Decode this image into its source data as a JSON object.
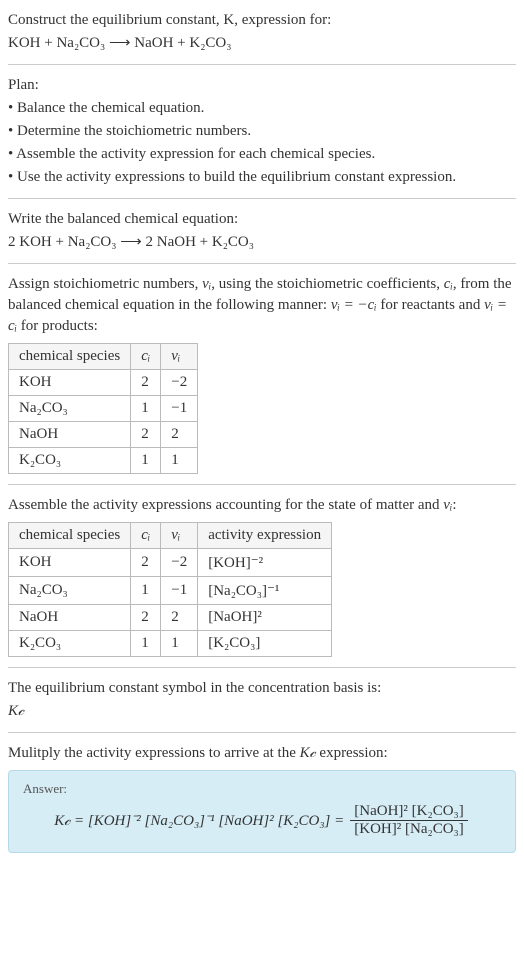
{
  "intro": {
    "line1": "Construct the equilibrium constant, K, expression for:",
    "eq": "KOH + Na₂CO₃ ⟶ NaOH + K₂CO₃"
  },
  "plan": {
    "title": "Plan:",
    "b1": "• Balance the chemical equation.",
    "b2": "• Determine the stoichiometric numbers.",
    "b3": "• Assemble the activity expression for each chemical species.",
    "b4": "• Use the activity expressions to build the equilibrium constant expression."
  },
  "balanced": {
    "title": "Write the balanced chemical equation:",
    "eq": "2 KOH + Na₂CO₃ ⟶ 2 NaOH + K₂CO₃"
  },
  "stoich": {
    "intro_a": "Assign stoichiometric numbers, ",
    "intro_b": ", using the stoichiometric coefficients, ",
    "intro_c": ", from the balanced chemical equation in the following manner: ",
    "intro_d": " for reactants and ",
    "intro_e": " for products:",
    "nu_i": "νᵢ",
    "c_i": "cᵢ",
    "rel_react": "νᵢ = −cᵢ",
    "rel_prod": "νᵢ = cᵢ",
    "h1": "chemical species",
    "h2": "cᵢ",
    "h3": "νᵢ",
    "r1s": "KOH",
    "r1c": "2",
    "r1n": "−2",
    "r2s": "Na₂CO₃",
    "r2c": "1",
    "r2n": "−1",
    "r3s": "NaOH",
    "r3c": "2",
    "r3n": "2",
    "r4s": "K₂CO₃",
    "r4c": "1",
    "r4n": "1"
  },
  "activity": {
    "intro_a": "Assemble the activity expressions accounting for the state of matter and ",
    "intro_b": ":",
    "nu_i": "νᵢ",
    "h1": "chemical species",
    "h2": "cᵢ",
    "h3": "νᵢ",
    "h4": "activity expression",
    "r1s": "KOH",
    "r1c": "2",
    "r1n": "−2",
    "r1a": "[KOH]⁻²",
    "r2s": "Na₂CO₃",
    "r2c": "1",
    "r2n": "−1",
    "r2a": "[Na₂CO₃]⁻¹",
    "r3s": "NaOH",
    "r3c": "2",
    "r3n": "2",
    "r3a": "[NaOH]²",
    "r4s": "K₂CO₃",
    "r4c": "1",
    "r4n": "1",
    "r4a": "[K₂CO₃]"
  },
  "kc_symbol": {
    "line": "The equilibrium constant symbol in the concentration basis is:",
    "sym": "K𝒸"
  },
  "multiply": {
    "line_a": "Mulitply the activity expressions to arrive at the ",
    "kc": "K𝒸",
    "line_b": " expression:"
  },
  "answer": {
    "label": "Answer:",
    "lhs": "K𝒸 = [KOH]⁻² [Na₂CO₃]⁻¹ [NaOH]² [K₂CO₃] = ",
    "frac_num": "[NaOH]² [K₂CO₃]",
    "frac_den": "[KOH]² [Na₂CO₃]"
  },
  "chart_data": {
    "type": "table",
    "tables": [
      {
        "title": "Stoichiometric numbers",
        "columns": [
          "chemical species",
          "cᵢ",
          "νᵢ"
        ],
        "rows": [
          [
            "KOH",
            2,
            -2
          ],
          [
            "Na₂CO₃",
            1,
            -1
          ],
          [
            "NaOH",
            2,
            2
          ],
          [
            "K₂CO₃",
            1,
            1
          ]
        ]
      },
      {
        "title": "Activity expressions",
        "columns": [
          "chemical species",
          "cᵢ",
          "νᵢ",
          "activity expression"
        ],
        "rows": [
          [
            "KOH",
            2,
            -2,
            "[KOH]^-2"
          ],
          [
            "Na₂CO₃",
            1,
            -1,
            "[Na₂CO₃]^-1"
          ],
          [
            "NaOH",
            2,
            2,
            "[NaOH]^2"
          ],
          [
            "K₂CO₃",
            1,
            1,
            "[K₂CO₃]"
          ]
        ]
      }
    ]
  }
}
